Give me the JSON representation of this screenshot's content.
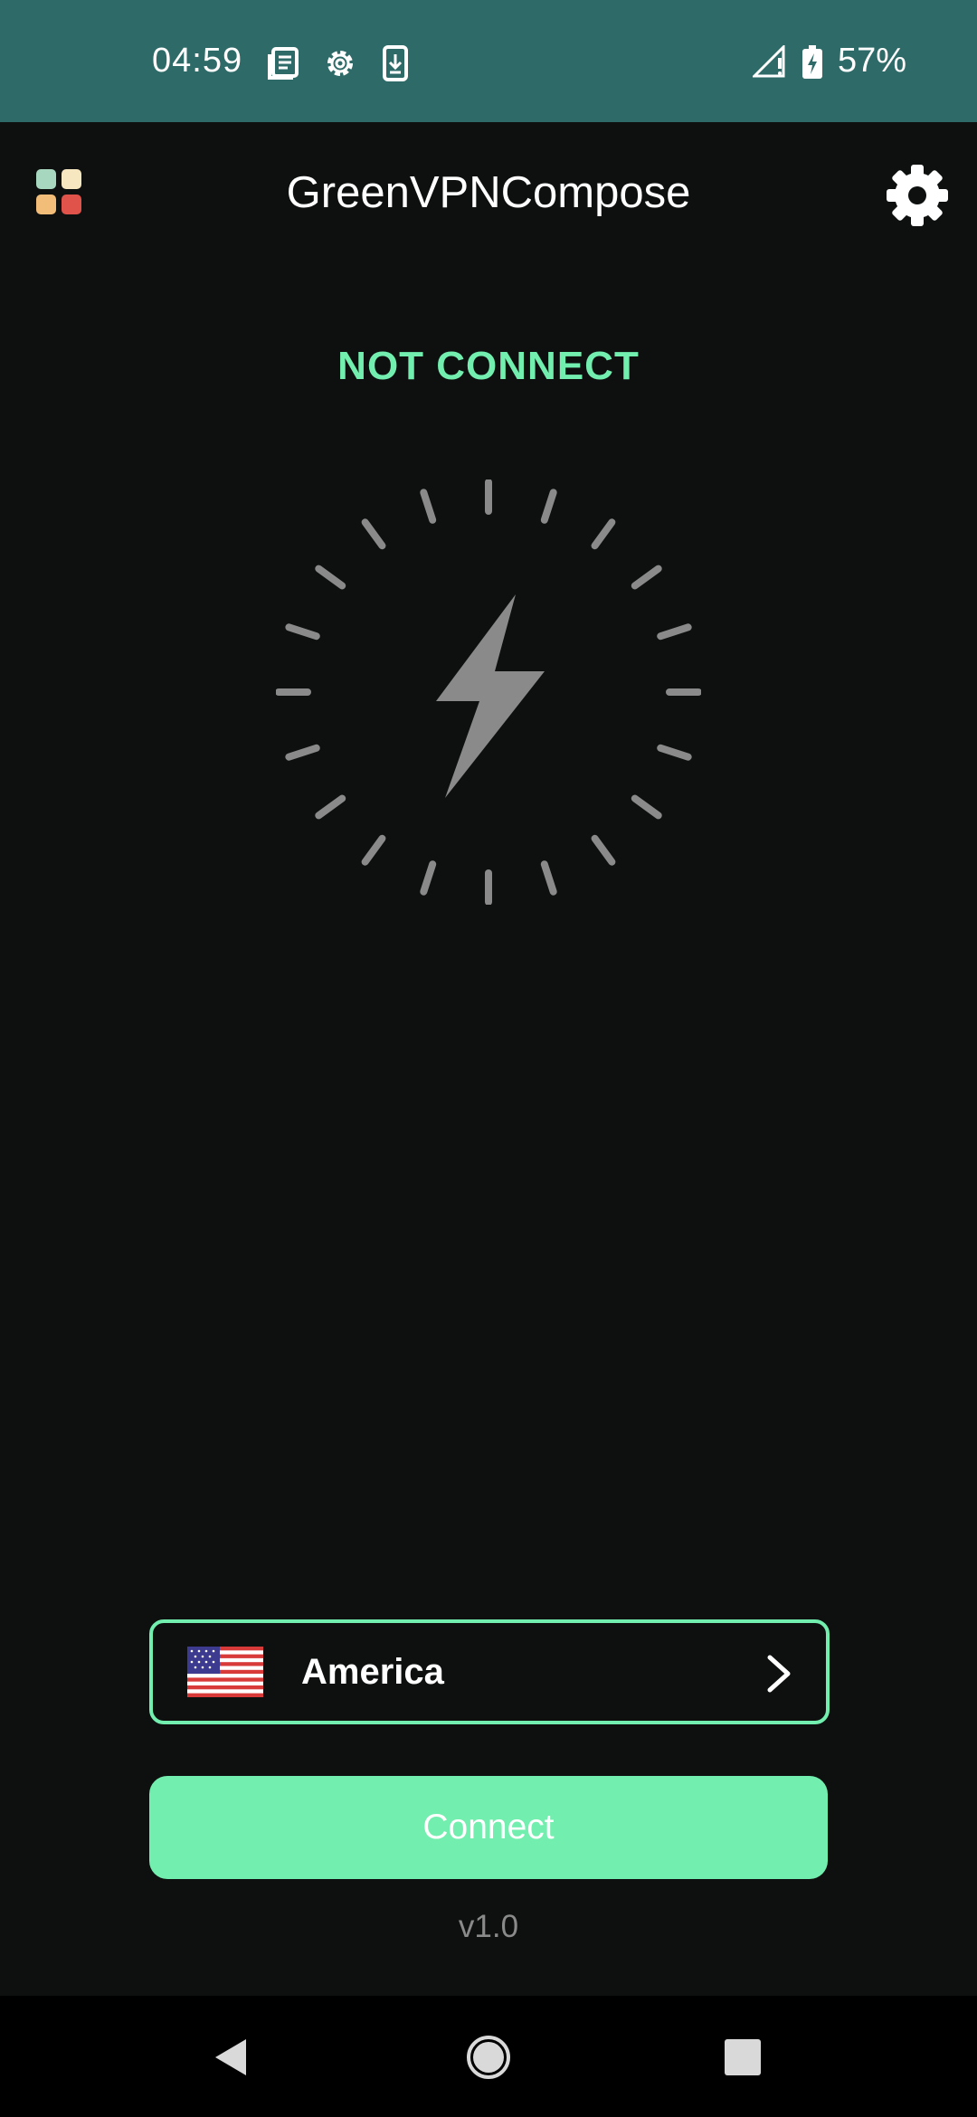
{
  "status_bar": {
    "time": "04:59",
    "left_icons": [
      "news-icon",
      "settings-gear-icon",
      "download-icon"
    ],
    "right_icons": [
      "signal-icon",
      "battery-charging-icon"
    ],
    "battery": "57%"
  },
  "header": {
    "title": "GreenVPNCompose",
    "menu_icon": "grid-apps-icon",
    "settings_icon": "gear-icon"
  },
  "connection": {
    "status": "NOT CONNECT",
    "status_color": "#72eeae",
    "power_icon": "lightning-bolt-icon"
  },
  "server": {
    "name": "America",
    "flag_icon": "us-flag-icon",
    "chevron_icon": "chevron-right-icon"
  },
  "actions": {
    "connect_label": "Connect",
    "connect_color": "#72eeae"
  },
  "footer": {
    "version": "v1.0"
  },
  "nav_bar": {
    "icons": [
      "back-icon",
      "home-icon",
      "recents-icon"
    ]
  },
  "colors": {
    "accent": "#72eeae",
    "background": "#0e1010",
    "status_bar": "#2e6b68",
    "grid_tiles": [
      "#a7d8bf",
      "#f6e7c1",
      "#f2bd78",
      "#e0534b"
    ],
    "dial_gray": "#8a8a8a"
  }
}
